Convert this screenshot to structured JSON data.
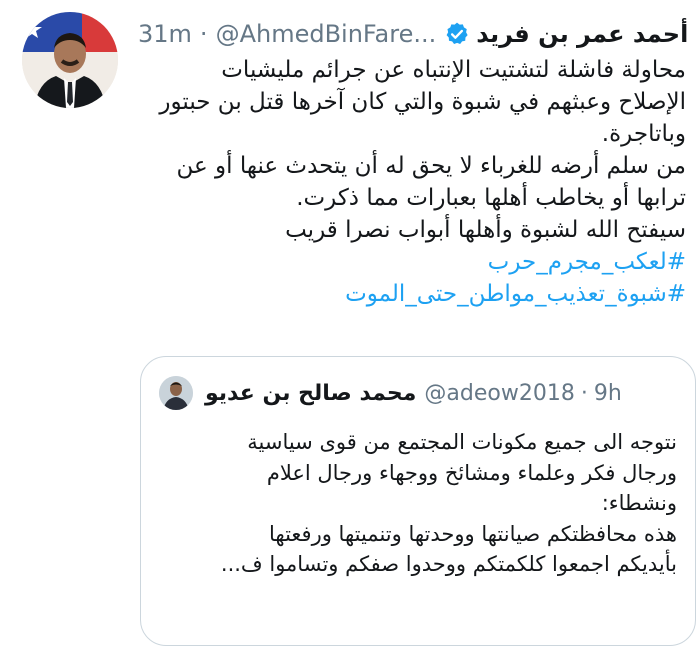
{
  "tweet": {
    "author_name": "أحمد عمر بن فريد",
    "handle": "@AhmedBinFare...",
    "separator": "·",
    "time": "31m",
    "body_lines": [
      "محاولة فاشلة لتشتيت الإنتباه عن جرائم مليشيات",
      "الإصلاح وعبثهم في شبوة والتي كان آخرها قتل بن حبتور",
      "وباتاجرة.",
      "من سلم أرضه للغرباء لا يحق له أن يتحدث عنها أو عن",
      "ترابها أو يخاطب أهلها بعبارات مما ذكرت.",
      "سيفتح الله لشبوة وأهلها أبواب نصرا قريب"
    ],
    "hashtags": [
      "#لعكب_مجرم_حرب",
      "#شبوة_تعذيب_مواطن_حتى_الموت"
    ]
  },
  "quoted": {
    "author_name": "محمد صالح بن عديو",
    "handle": "@adeow2018",
    "separator": "·",
    "time": "9h",
    "body_lines": [
      "نتوجه الى جميع مكونات المجتمع  من قوى سياسية",
      "ورجال فكر وعلماء ومشائخ ووجهاء ورجال اعلام",
      "ونشطاء:",
      "هذه محافظتكم صيانتها ووحدتها وتنميتها  ورفعتها",
      "بأيديكم  اجمعوا كلكمتكم ووحدوا صفكم وتساموا ف..."
    ]
  },
  "colors": {
    "link": "#1da1f2",
    "muted": "#657786",
    "text": "#14171a",
    "border": "#ccd6dd",
    "verified": "#1da1f2"
  },
  "icons": {
    "verified": "verified-badge-icon"
  }
}
